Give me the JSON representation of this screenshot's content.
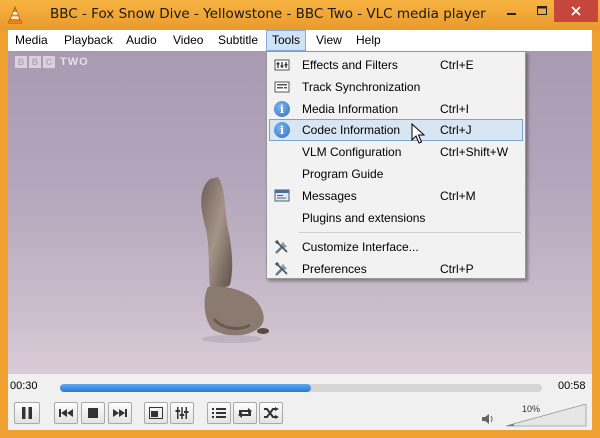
{
  "window": {
    "title": "BBC - Fox Snow Dive - Yellowstone - BBC Two - VLC media player",
    "minimize_icon": "minimize-icon",
    "maximize_icon": "maximize-icon",
    "close_icon": "close-icon"
  },
  "menubar": {
    "items": [
      {
        "label": "Media"
      },
      {
        "label": "Playback"
      },
      {
        "label": "Audio"
      },
      {
        "label": "Video"
      },
      {
        "label": "Subtitle"
      },
      {
        "label": "Tools",
        "active": true
      },
      {
        "label": "View"
      },
      {
        "label": "Help"
      }
    ]
  },
  "video": {
    "channel_logo_letters": [
      "B",
      "B",
      "C"
    ],
    "channel_name": "TWO"
  },
  "tools_menu": {
    "items": [
      {
        "label": "Effects and Filters",
        "shortcut": "Ctrl+E",
        "icon": "equalizer-icon"
      },
      {
        "label": "Track Synchronization",
        "shortcut": "",
        "icon": "sync-icon"
      },
      {
        "label": "Media Information",
        "shortcut": "Ctrl+I",
        "icon": "info-icon"
      },
      {
        "label": "Codec Information",
        "shortcut": "Ctrl+J",
        "icon": "info-icon",
        "highlighted": true
      },
      {
        "label": "VLM Configuration",
        "shortcut": "Ctrl+Shift+W",
        "icon": ""
      },
      {
        "label": "Program Guide",
        "shortcut": "",
        "icon": ""
      },
      {
        "label": "Messages",
        "shortcut": "Ctrl+M",
        "icon": "messages-icon"
      },
      {
        "label": "Plugins and extensions",
        "shortcut": "",
        "icon": ""
      },
      {
        "label": "Customize Interface...",
        "shortcut": "",
        "icon": "tools-icon"
      },
      {
        "label": "Preferences",
        "shortcut": "Ctrl+P",
        "icon": "tools-icon"
      }
    ]
  },
  "controls": {
    "elapsed": "00:30",
    "total": "00:58",
    "progress": 0.52,
    "volume_label": "10%",
    "volume": 0.1
  }
}
